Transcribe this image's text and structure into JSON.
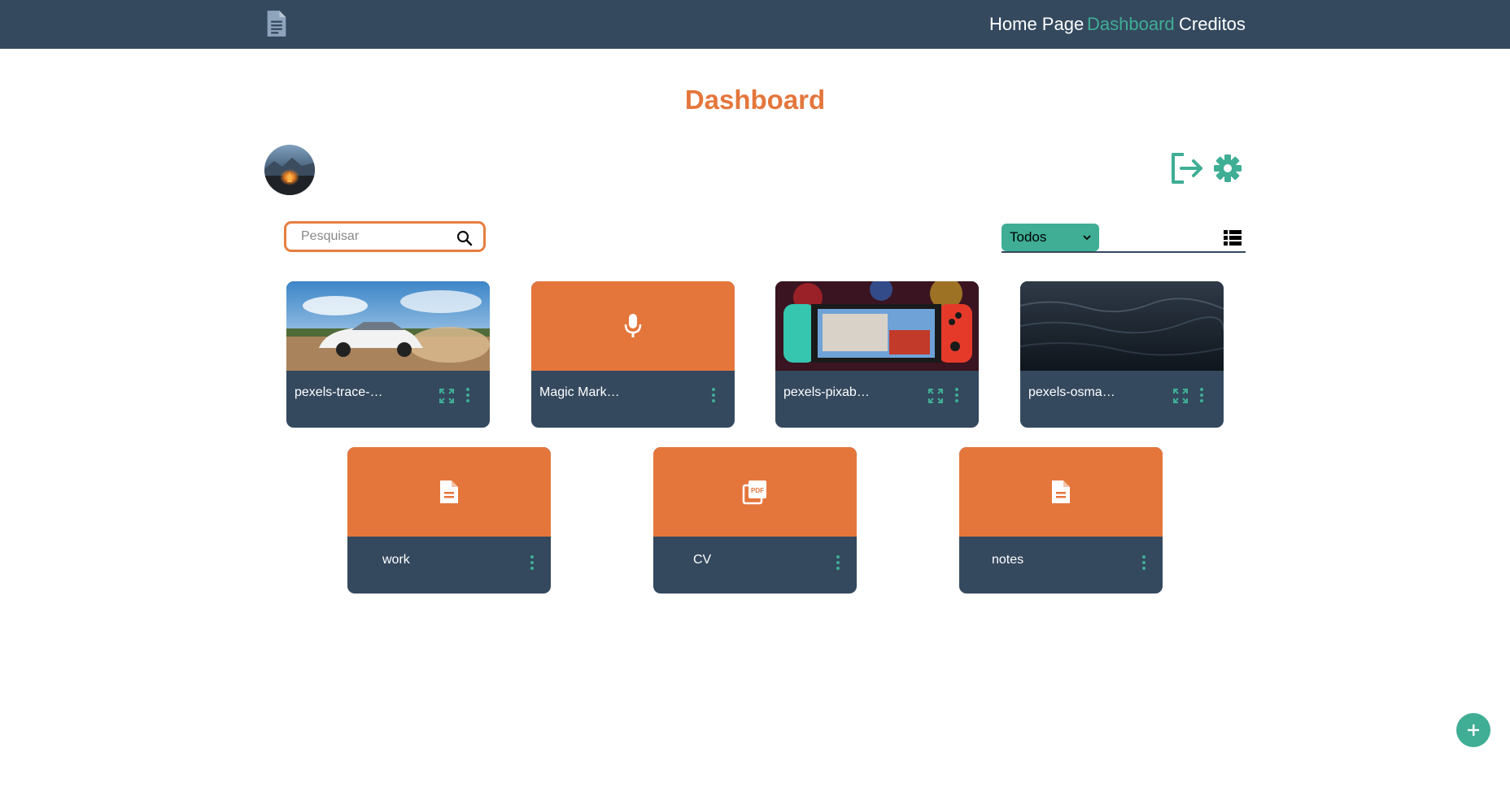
{
  "nav": {
    "home": "Home Page",
    "dashboard": "Dashboard",
    "creditos": "Creditos"
  },
  "page": {
    "title": "Dashboard"
  },
  "search": {
    "placeholder": "Pesquisar"
  },
  "filter": {
    "selected": "Todos"
  },
  "files": [
    {
      "name": "pexels-trace-…",
      "thumb": "car-photo"
    },
    {
      "name": "Magic Mark…",
      "thumb": "microphone-icon"
    },
    {
      "name": "pexels-pixab…",
      "thumb": "switch-photo"
    },
    {
      "name": "pexels-osma…",
      "thumb": "water-photo"
    },
    {
      "name": "work",
      "thumb": "document-icon"
    },
    {
      "name": "CV",
      "thumb": "pdf-icon"
    },
    {
      "name": "notes",
      "thumb": "document-icon"
    }
  ],
  "icons": [
    "file-logo-icon",
    "logout-icon",
    "gear-icon",
    "search-icon",
    "chevron-down-icon",
    "list-view-icon",
    "expand-icon",
    "more-vertical-icon",
    "plus-icon"
  ],
  "colors": {
    "header": "#34495e",
    "accent_orange": "#e4763c",
    "accent_teal": "#3fae95",
    "card_footer": "#34495e"
  }
}
